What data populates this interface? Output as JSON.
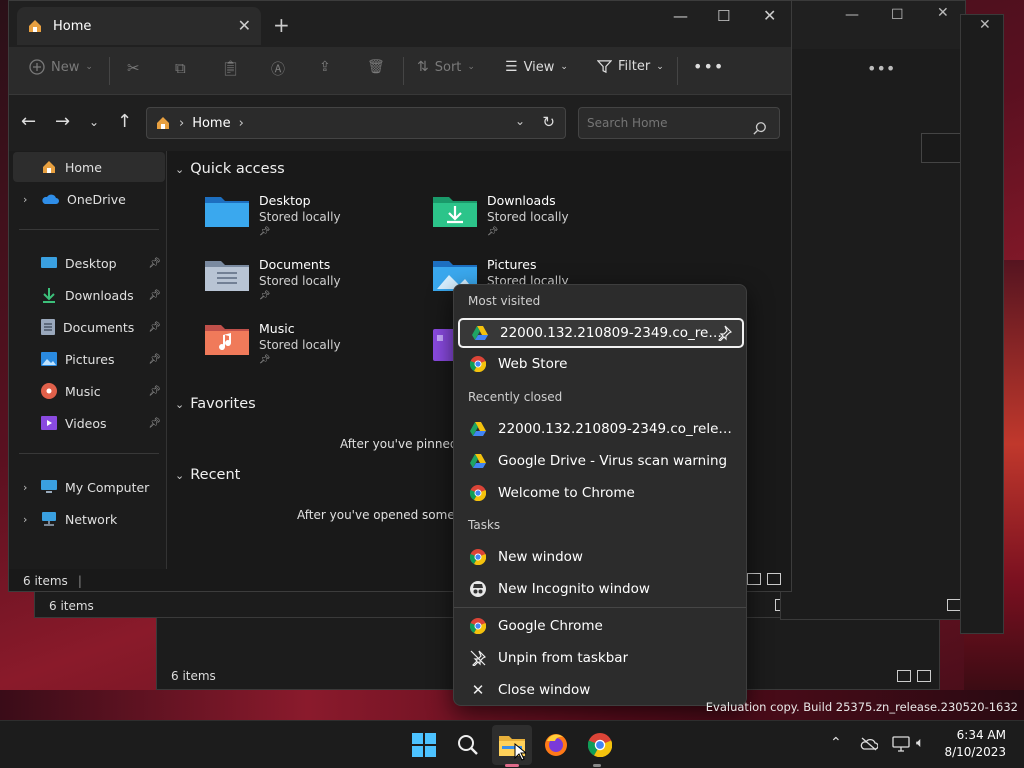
{
  "explorer": {
    "tab_title": "Home",
    "toolbar": {
      "new": "New",
      "sort": "Sort",
      "view": "View",
      "filter": "Filter"
    },
    "address": {
      "location": "Home"
    },
    "search": {
      "placeholder": "Search Home"
    },
    "sidebar": {
      "home": "Home",
      "onedrive": "OneDrive",
      "pinned": [
        "Desktop",
        "Downloads",
        "Documents",
        "Pictures",
        "Music",
        "Videos"
      ],
      "my_computer": "My Computer",
      "network": "Network"
    },
    "sections": {
      "quick_access": "Quick access",
      "favorites": "Favorites",
      "recent": "Recent"
    },
    "folders": [
      {
        "name": "Desktop",
        "sub": "Stored locally"
      },
      {
        "name": "Downloads",
        "sub": "Stored locally"
      },
      {
        "name": "Documents",
        "sub": "Stored locally"
      },
      {
        "name": "Pictures",
        "sub": "Stored locally"
      },
      {
        "name": "Music",
        "sub": "Stored locally"
      }
    ],
    "favorites_hint": "After you've pinned s",
    "recent_hint": "After you've opened some file",
    "status": "6 items",
    "bg_status_1": "6 items",
    "bg_status_2": "6 items"
  },
  "jumplist": {
    "most_visited_header": "Most visited",
    "most_visited": [
      "22000.132.210809-2349.co_rele...",
      "Web Store"
    ],
    "recently_closed_header": "Recently closed",
    "recently_closed": [
      "22000.132.210809-2349.co_release_s...",
      "Google Drive - Virus scan warning",
      "Welcome to Chrome"
    ],
    "tasks_header": "Tasks",
    "tasks": [
      "New window",
      "New Incognito window"
    ],
    "app": [
      "Google Chrome",
      "Unpin from taskbar",
      "Close window"
    ]
  },
  "watermark": "Evaluation copy. Build 25375.zn_release.230520-1632",
  "clock": {
    "time": "6:34 AM",
    "date": "8/10/2023"
  }
}
